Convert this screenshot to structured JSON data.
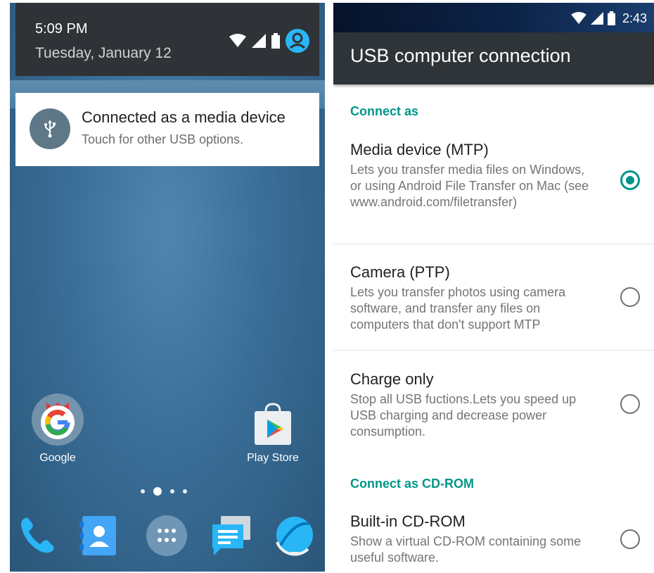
{
  "left": {
    "notification_header": {
      "time": "5:09 PM",
      "date": "Tuesday, January 12",
      "icons": [
        "wifi-icon",
        "signal-icon",
        "battery-icon",
        "account-icon"
      ]
    },
    "notification": {
      "icon": "usb-icon",
      "title": "Connected as a media device",
      "subtitle": "Touch for other USB options."
    },
    "home_apps": [
      {
        "label": "Google",
        "icon": "google-icon"
      },
      {
        "label": "Play Store",
        "icon": "play-store-icon"
      }
    ],
    "page_indicator": {
      "count": 4,
      "active_index": 1
    },
    "dock": [
      "phone-icon",
      "contacts-icon",
      "app-drawer-icon",
      "messaging-icon",
      "browser-icon"
    ]
  },
  "right": {
    "status_bar": {
      "time": "2:43",
      "icons": [
        "wifi-icon",
        "signal-icon",
        "battery-icon"
      ]
    },
    "app_bar_title": "USB computer connection",
    "sections": [
      {
        "header": "Connect as",
        "options": [
          {
            "title": "Media device (MTP)",
            "description": "Lets you transfer media files on Windows, or using Android File Transfer on Mac (see www.android.com/filetransfer)",
            "selected": true
          },
          {
            "title": "Camera (PTP)",
            "description": "Lets you transfer photos using camera software, and transfer any files on computers that don't support MTP",
            "selected": false
          },
          {
            "title": "Charge only",
            "description": "Stop all USB fuctions.Lets you speed up USB charging and decrease power consumption.",
            "selected": false
          }
        ]
      },
      {
        "header": "Connect as CD-ROM",
        "options": [
          {
            "title": "Built-in CD-ROM",
            "description": "Show a virtual CD-ROM containing some useful software.",
            "selected": false
          }
        ]
      }
    ]
  },
  "colors": {
    "accent": "#009688",
    "app_bar": "#2e3438",
    "notification_header": "#2f3337",
    "usb_badge": "#5e7888"
  }
}
